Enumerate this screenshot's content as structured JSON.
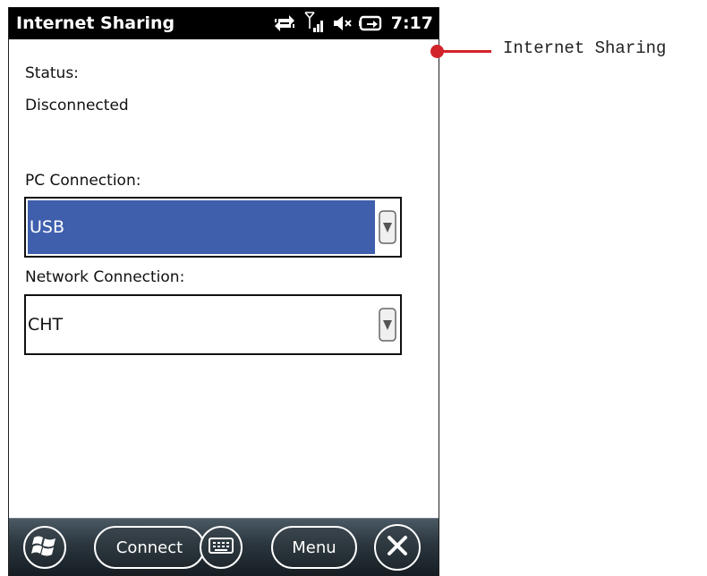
{
  "window": {
    "title": "Internet Sharing",
    "clock": "7:17",
    "status_icons": [
      "sync-arrows-icon",
      "signal-strength-icon",
      "speaker-muted-icon",
      "battery-charging-icon"
    ]
  },
  "form": {
    "status_label": "Status:",
    "status_value": "Disconnected",
    "pc_connection_label": "PC Connection:",
    "pc_connection_value": "USB",
    "network_connection_label": "Network Connection:",
    "network_connection_value": "CHT"
  },
  "softkeys": {
    "start_icon": "windows-start-icon",
    "connect_label": "Connect",
    "keyboard_icon": "keyboard-icon",
    "menu_label": "Menu",
    "close_icon": "close-icon"
  },
  "annotation": {
    "label": "Internet Sharing",
    "color": "#d2232a"
  },
  "colors": {
    "selection": "#3f5fad",
    "titlebar": "#000000"
  }
}
